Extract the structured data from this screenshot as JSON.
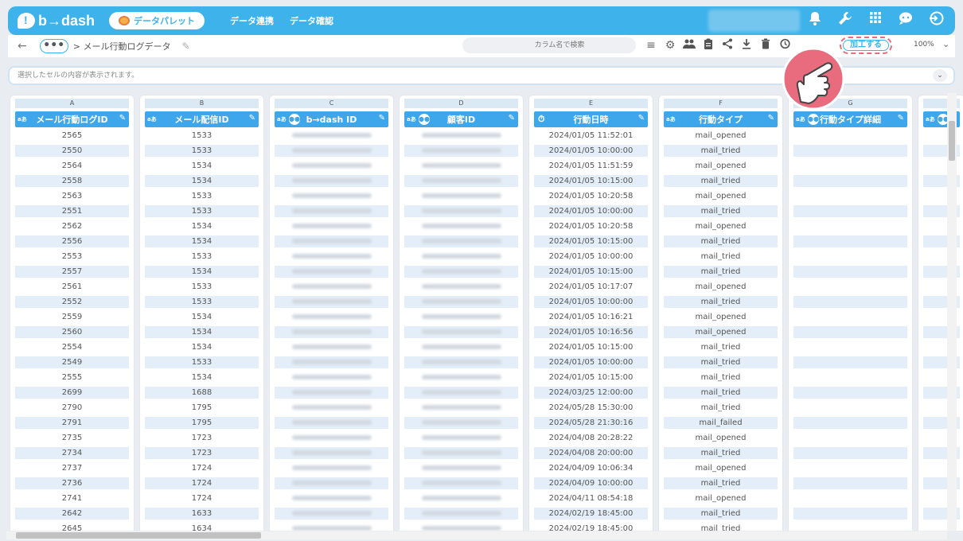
{
  "app": {
    "logo_text": "b→dash",
    "palette_label": "データパレット",
    "nav": [
      "データ連携",
      "データ確認"
    ]
  },
  "toolbar": {
    "dots": "•••",
    "breadcrumb": "> メール行動ログデータ",
    "search_placeholder": "カラム名で検索",
    "process_label": "加工する",
    "zoom": "100%"
  },
  "cellbar": {
    "placeholder": "選択したセルの内容が表示されます。"
  },
  "columns": [
    {
      "letter": "A",
      "label": "メール行動ログID",
      "icon": "text-badge-icon"
    },
    {
      "letter": "B",
      "label": "メール配信ID",
      "icon": "text-badge-icon"
    },
    {
      "letter": "C",
      "label": "b→dash ID",
      "icon": "people-icon"
    },
    {
      "letter": "D",
      "label": "顧客ID",
      "icon": "people-icon"
    },
    {
      "letter": "E",
      "label": "行動日時",
      "icon": "clock-icon"
    },
    {
      "letter": "F",
      "label": "行動タイプ",
      "icon": "text-badge-icon"
    },
    {
      "letter": "G",
      "label": "行動タイプ詳細",
      "icon": "people-icon"
    }
  ],
  "col_a": [
    "2565",
    "2550",
    "2564",
    "2558",
    "2563",
    "2551",
    "2562",
    "2556",
    "2553",
    "2557",
    "2561",
    "2552",
    "2559",
    "2560",
    "2554",
    "2549",
    "2555",
    "2699",
    "2790",
    "2791",
    "2735",
    "2734",
    "2737",
    "2736",
    "2741",
    "2642",
    "2645"
  ],
  "col_b": [
    "1533",
    "1533",
    "1534",
    "1534",
    "1533",
    "1533",
    "1534",
    "1534",
    "1533",
    "1534",
    "1533",
    "1533",
    "1534",
    "1534",
    "1534",
    "1533",
    "1534",
    "1688",
    "1795",
    "1795",
    "1723",
    "1723",
    "1724",
    "1724",
    "1724",
    "1633",
    "1634"
  ],
  "col_e": [
    "2024/01/05 11:52:01",
    "2024/01/05 10:00:00",
    "2024/01/05 11:51:59",
    "2024/01/05 10:15:00",
    "2024/01/05 10:20:58",
    "2024/01/05 10:00:00",
    "2024/01/05 10:20:58",
    "2024/01/05 10:15:00",
    "2024/01/05 10:00:00",
    "2024/01/05 10:15:00",
    "2024/01/05 10:17:07",
    "2024/01/05 10:00:00",
    "2024/01/05 10:16:21",
    "2024/01/05 10:16:56",
    "2024/01/05 10:15:00",
    "2024/01/05 10:00:00",
    "2024/01/05 10:15:00",
    "2024/03/25 12:00:00",
    "2024/05/28 15:30:00",
    "2024/05/28 21:30:16",
    "2024/04/08 20:28:22",
    "2024/04/08 20:00:00",
    "2024/04/09 10:06:34",
    "2024/04/09 10:00:00",
    "2024/04/11 08:54:18",
    "2024/02/19 18:45:00",
    "2024/02/19 18:45:00"
  ],
  "col_f": [
    "mail_opened",
    "mail_tried",
    "mail_opened",
    "mail_tried",
    "mail_opened",
    "mail_tried",
    "mail_opened",
    "mail_tried",
    "mail_tried",
    "mail_tried",
    "mail_opened",
    "mail_tried",
    "mail_opened",
    "mail_opened",
    "mail_tried",
    "mail_tried",
    "mail_tried",
    "mail_tried",
    "mail_tried",
    "mail_failed",
    "mail_opened",
    "mail_tried",
    "mail_opened",
    "mail_tried",
    "mail_opened",
    "mail_tried",
    "mail_tried"
  ]
}
